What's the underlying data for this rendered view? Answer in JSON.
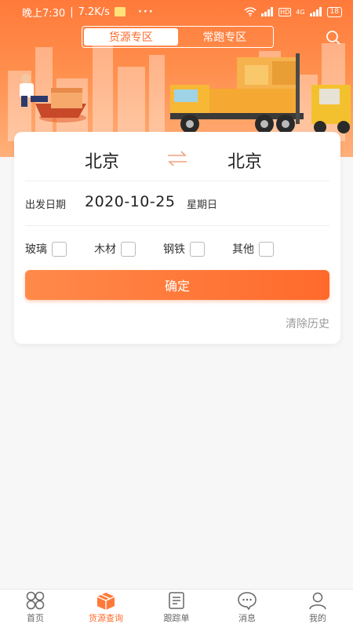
{
  "status_bar": {
    "time": "晚上7:30",
    "speed": "7.2K/s",
    "more": "···",
    "hd": "HD",
    "network": "4G",
    "battery": "18"
  },
  "segment": {
    "tabs": [
      {
        "label": "货源专区",
        "active": true
      },
      {
        "label": "常跑专区",
        "active": false
      }
    ]
  },
  "route": {
    "from": "北京",
    "to": "北京",
    "swap_icon": "swap-arrows-icon"
  },
  "date": {
    "label": "出发日期",
    "value": "2020-10-25",
    "weekday": "星期日"
  },
  "cargo_types": [
    {
      "label": "玻璃"
    },
    {
      "label": "木材"
    },
    {
      "label": "钢铁"
    },
    {
      "label": "其他"
    }
  ],
  "confirm_label": "确定",
  "clear_history": "清除历史",
  "accent_color": "#ff6a2b",
  "tabbar": [
    {
      "label": "首页",
      "icon": "home-grid-icon"
    },
    {
      "label": "货源查询",
      "icon": "cargo-box-icon",
      "active": true
    },
    {
      "label": "跟踪单",
      "icon": "document-icon"
    },
    {
      "label": "消息",
      "icon": "chat-bubble-icon"
    },
    {
      "label": "我的",
      "icon": "user-icon"
    }
  ]
}
